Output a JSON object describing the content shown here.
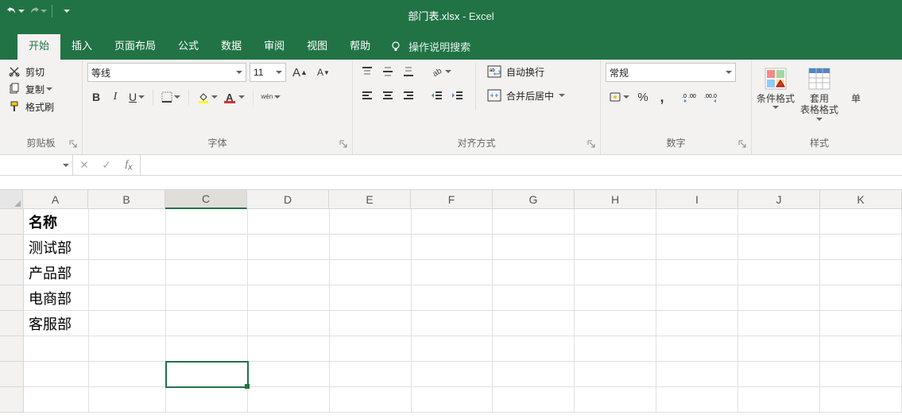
{
  "title": {
    "filename": "部门表.xlsx",
    "app": "Excel",
    "sep": "  -  "
  },
  "tabs": [
    "开始",
    "插入",
    "页面布局",
    "公式",
    "数据",
    "审阅",
    "视图",
    "帮助"
  ],
  "tellme": "操作说明搜索",
  "ribbon": {
    "clipboard": {
      "cut": "剪切",
      "copy": "复制",
      "painter": "格式刷",
      "group": "剪贴板"
    },
    "font": {
      "name": "等线",
      "size": "11",
      "group": "字体",
      "pinyin": "wén"
    },
    "align": {
      "wrap": "自动换行",
      "merge": "合并后居中",
      "group": "对齐方式"
    },
    "number": {
      "format": "常规",
      "group": "数字"
    },
    "styles": {
      "cond": "条件格式",
      "table": "套用\n表格格式",
      "cell": "单",
      "group": "样式"
    }
  },
  "namebox": "",
  "columns": [
    "A",
    "B",
    "C",
    "D",
    "E",
    "F",
    "G",
    "H",
    "I",
    "J",
    "K"
  ],
  "activeCol": "C",
  "cells": {
    "A1": "名称",
    "A2": "测试部",
    "A3": "产品部",
    "A4": "电商部",
    "A5": "客服部"
  },
  "activeCell": "C7"
}
